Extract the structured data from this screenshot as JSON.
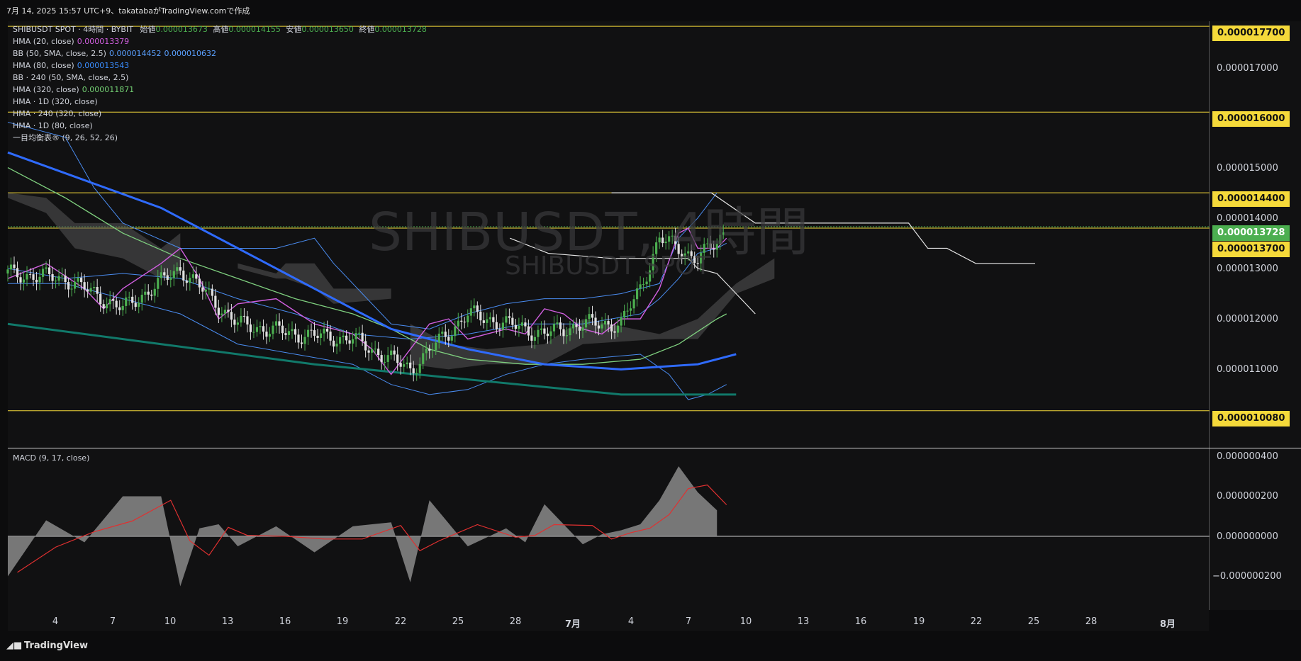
{
  "header": {
    "text": "7月 14, 2025 15:57 UTC+9、takatabaがTradingView.comで作成"
  },
  "legend": {
    "title": "SHIBUSDT SPOT · 4時間 · BYBIT",
    "ohlc": [
      {
        "label": "始値",
        "value": "0.000013673"
      },
      {
        "label": "高値",
        "value": "0.000014155"
      },
      {
        "label": "安値",
        "value": "0.000013650"
      },
      {
        "label": "終値",
        "value": "0.000013728"
      }
    ],
    "indicators": [
      {
        "name": "HMA (20, close)",
        "value": "0.000013379",
        "color": "#d15fe0"
      },
      {
        "name": "BB (50, SMA, close, 2.5)",
        "value": "0.000014452",
        "value2": "0.000010632",
        "color": "#5aa0ff"
      },
      {
        "name": "HMA (80, close)",
        "value": "0.000013543",
        "color": "#3a8dff"
      },
      {
        "name": "BB · 240 (50, SMA, close, 2.5)",
        "value": "",
        "color": ""
      },
      {
        "name": "HMA (320, close)",
        "value": "0.000011871",
        "color": "#74d174"
      },
      {
        "name": "HMA · 1D (320, close)",
        "value": "",
        "color": ""
      },
      {
        "name": "HMA · 240 (320, close)",
        "value": "",
        "color": ""
      },
      {
        "name": "HMA · 1D (80, close)",
        "value": "",
        "color": ""
      },
      {
        "name": "一目均衡表® (9, 26, 52, 26)",
        "value": "",
        "color": ""
      }
    ]
  },
  "watermark": {
    "main": "SHIBUSDT, 4時間",
    "sub": "SHIBUSDT SPOT"
  },
  "price_axis": {
    "ticks": [
      "0.000017000",
      "0.000015000",
      "0.000014000",
      "0.000013000",
      "0.000012000",
      "0.000011000"
    ],
    "levels": [
      {
        "label": "0.000017700",
        "kind": "hline"
      },
      {
        "label": "0.000016000",
        "kind": "hline"
      },
      {
        "label": "0.000014400",
        "kind": "hline"
      },
      {
        "label": "0.000013728",
        "kind": "current"
      },
      {
        "label": "0.000013700",
        "kind": "hline"
      },
      {
        "label": "0.000010080",
        "kind": "hline"
      }
    ]
  },
  "macd": {
    "title": "MACD (9, 17, close)",
    "ticks": [
      "0.000000400",
      "0.000000200",
      "0.000000000",
      "−0.000000200"
    ]
  },
  "time_axis": [
    "4",
    "7",
    "10",
    "13",
    "16",
    "19",
    "22",
    "25",
    "28",
    "7月",
    "4",
    "7",
    "10",
    "13",
    "16",
    "19",
    "22",
    "25",
    "28",
    "8月"
  ],
  "footer": {
    "brand": "TradingView"
  },
  "colors": {
    "up": "#4caf50",
    "down": "#e0e0e0",
    "hline": "#f5d93a",
    "current": "#4caf50",
    "hma80": "#2f6bff",
    "hma320": "#11796a",
    "hma320b": "#7fd07f",
    "hma20": "#d15fe0",
    "bb": "#4a8cf0",
    "cloud": "#555555",
    "macd_hist": "#8a8a8a",
    "macd_signal": "#e03030"
  },
  "chart_data": [
    {
      "type": "line",
      "title": "SHIBUSDT SPOT · 4時間 · BYBIT",
      "x_ticks": [
        "4",
        "7",
        "10",
        "13",
        "16",
        "19",
        "22",
        "25",
        "28",
        "7月",
        "4",
        "7",
        "10",
        "13",
        "16",
        "19",
        "22",
        "25",
        "28",
        "8月"
      ],
      "ylim": [
        1e-05,
        1.82e-05
      ],
      "series": [
        {
          "name": "SHIBUSDT (close, approx)",
          "x": [
            0,
            3,
            6,
            9,
            12,
            15,
            18,
            21,
            24,
            25,
            28,
            30,
            32,
            33,
            34,
            36,
            37,
            37.5
          ],
          "values": [
            1.28e-05,
            1.27e-05,
            1.21e-05,
            1.29e-05,
            1.18e-05,
            1.16e-05,
            1.15e-05,
            1.09e-05,
            1.2e-05,
            1.19e-05,
            1.16e-05,
            1.18e-05,
            1.18e-05,
            1.25e-05,
            1.35e-05,
            1.31e-05,
            1.34e-05,
            1.37e-05
          ]
        },
        {
          "name": "HMA (80, close)",
          "x": [
            0,
            8,
            16,
            20,
            24,
            28,
            32,
            36,
            38
          ],
          "values": [
            1.52e-05,
            1.41e-05,
            1.25e-05,
            1.17e-05,
            1.13e-05,
            1.1e-05,
            1.09e-05,
            1.1e-05,
            1.12e-05
          ]
        },
        {
          "name": "HMA (320, close)",
          "x": [
            0,
            8,
            16,
            24,
            32,
            38
          ],
          "values": [
            1.18e-05,
            1.14e-05,
            1.1e-05,
            1.07e-05,
            1.04e-05,
            1.04e-05
          ]
        }
      ]
    },
    {
      "type": "area",
      "title": "MACD (9, 17, close)",
      "ylim": [
        -3.5e-07,
        4.2e-07
      ],
      "x": [
        0,
        2,
        4,
        6,
        8,
        9,
        10,
        11,
        12,
        14,
        16,
        18,
        20,
        21,
        22,
        24,
        26,
        27,
        28,
        30,
        31,
        32,
        33,
        34,
        35,
        36,
        37
      ],
      "values": [
        -2e-07,
        8e-08,
        -3e-08,
        2e-07,
        2e-07,
        -2.5e-07,
        4e-08,
        6e-08,
        -5e-08,
        5e-08,
        -8e-08,
        5e-08,
        7e-08,
        -2.3e-07,
        1.8e-07,
        -5e-08,
        4e-08,
        -3e-08,
        1.6e-07,
        -4e-08,
        1e-08,
        3e-08,
        6e-08,
        1.8e-07,
        3.5e-07,
        2.2e-07,
        1.3e-07
      ]
    }
  ]
}
